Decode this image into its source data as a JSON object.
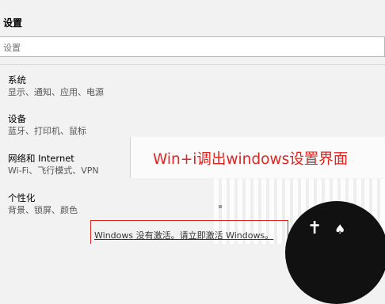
{
  "window": {
    "title": "设置"
  },
  "search": {
    "placeholder": "设置"
  },
  "categories": [
    {
      "title": "系统",
      "desc": "显示、通知、应用、电源"
    },
    {
      "title": "设备",
      "desc": "蓝牙、打印机、鼠标"
    },
    {
      "title": "网络和 Internet",
      "desc": "Wi-Fi、飞行模式、VPN"
    },
    {
      "title": "个性化",
      "desc": "背景、锁屏、颜色"
    }
  ],
  "annotation": {
    "text": "Win+i调出windows设置界面",
    "color": "#e0241f"
  },
  "activation": {
    "text": "Windows 没有激活。请立即激活 Windows。"
  },
  "colors": {
    "background": "#f2f2f2",
    "accent_red": "#e0241f"
  }
}
